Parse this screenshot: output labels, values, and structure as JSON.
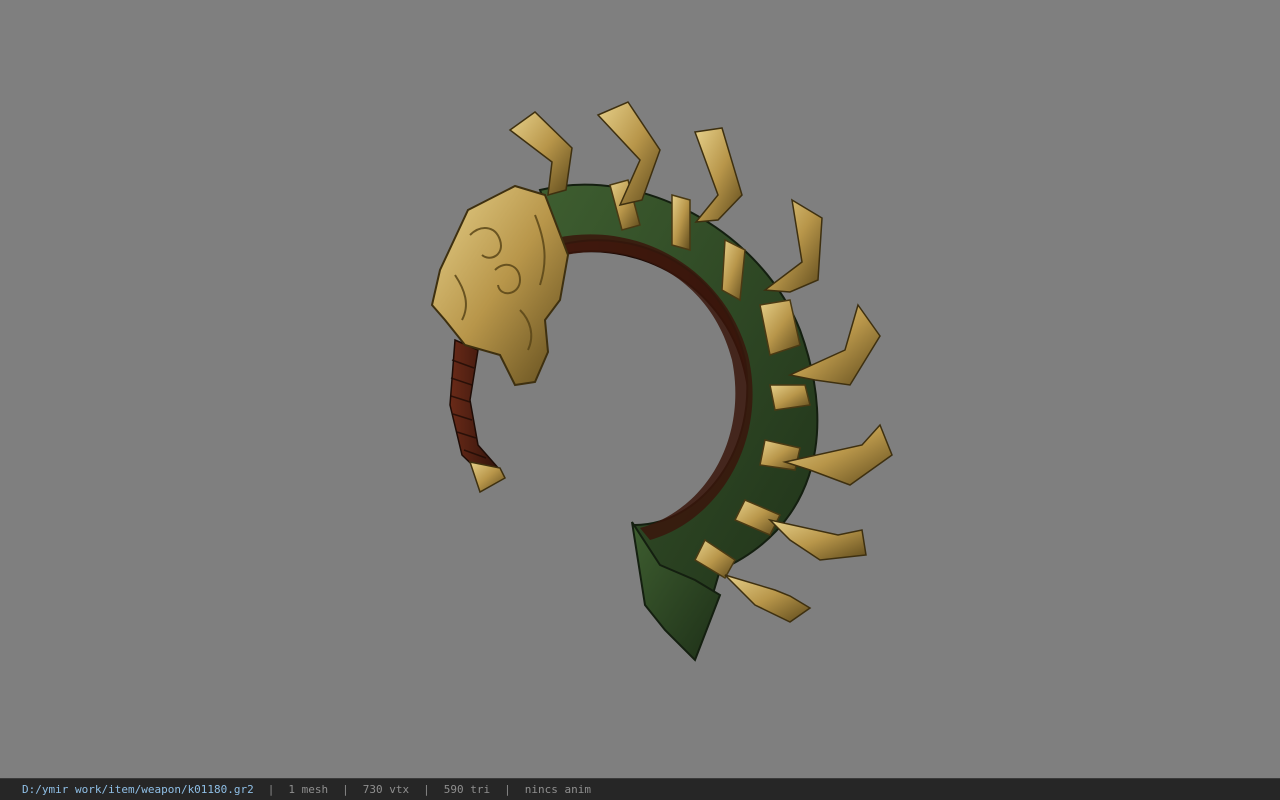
{
  "viewport": {
    "background": "#7f7f7f",
    "model_icon": "curved-blade-weapon-model"
  },
  "status": {
    "path": "D:/ymir work/item/weapon/k01180.gr2",
    "separator": "|",
    "mesh": "1 mesh",
    "vertices": "730 vtx",
    "triangles": "590 tri",
    "anim": "nincs anim"
  },
  "colors": {
    "gold": "#b8964a",
    "gold_dark": "#6e5a24",
    "green": "#2f4a26",
    "brown": "#4a1e12"
  }
}
